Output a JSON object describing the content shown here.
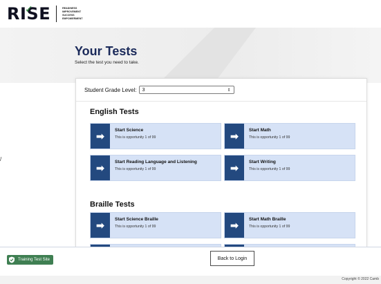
{
  "header": {
    "logo_word": "RISE",
    "tagline": [
      "READINESS",
      "IMPROVEMENT",
      "SUCCESS",
      "EMPOWERMENT"
    ]
  },
  "hero": {
    "title": "Your Tests",
    "subtitle": "Select the test you need to take."
  },
  "grade": {
    "label": "Student Grade Level:",
    "selected": "3"
  },
  "sections": {
    "english": {
      "title": "English Tests",
      "tests": [
        {
          "title": "Start Science",
          "sub": "This is opportunity 1 of 99"
        },
        {
          "title": "Start Math",
          "sub": "This is opportunity 1 of 99"
        },
        {
          "title": "Start Reading Language and Listening",
          "sub": "This is opportunity 1 of 99"
        },
        {
          "title": "Start Writing",
          "sub": "This is opportunity 1 of 99"
        }
      ]
    },
    "braille": {
      "title": "Braille Tests",
      "tests": [
        {
          "title": "Start Science Braille",
          "sub": "This is opportunity 1 of 99"
        },
        {
          "title": "Start Math Braille",
          "sub": "This is opportunity 1 of 99"
        }
      ]
    }
  },
  "stray_mark": "/",
  "footer": {
    "training_label": "Training Test Site",
    "back_label": "Back to Login",
    "copyright": "Copyright © 2022 Camb"
  },
  "colors": {
    "card_bg": "#d6e2f6",
    "arrow_bg": "#23497f",
    "title_navy": "#1b2a5a",
    "training_green": "#3f7f52"
  },
  "icons": {
    "arrow": "arrow-right-icon",
    "training": "shield-check-icon",
    "select": "chevron-updown-icon"
  }
}
